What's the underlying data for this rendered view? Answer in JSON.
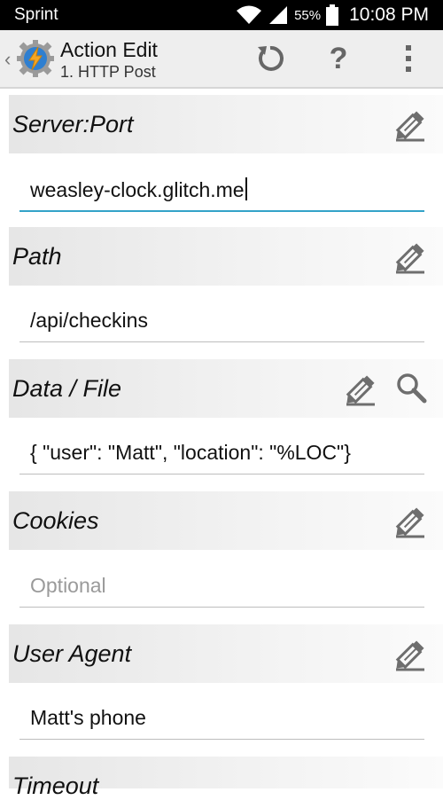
{
  "status_bar": {
    "carrier": "Sprint",
    "battery": "55%",
    "time": "10:08 PM"
  },
  "action_bar": {
    "title": "Action Edit",
    "subtitle": "1. HTTP Post",
    "help_label": "?"
  },
  "sections": {
    "server_port": {
      "label": "Server:Port",
      "value": "weasley-clock.glitch.me"
    },
    "path": {
      "label": "Path",
      "value": "/api/checkins"
    },
    "data_file": {
      "label": "Data / File",
      "value": "{ \"user\": \"Matt\", \"location\": \"%LOC\"}"
    },
    "cookies": {
      "label": "Cookies",
      "placeholder": "Optional"
    },
    "user_agent": {
      "label": "User Agent",
      "value": "Matt's phone"
    },
    "timeout": {
      "label": "Timeout"
    }
  },
  "colors": {
    "accent": "#33a3c8",
    "logo_orange": "#f5a623",
    "icon_gray": "#6e6e6e"
  }
}
